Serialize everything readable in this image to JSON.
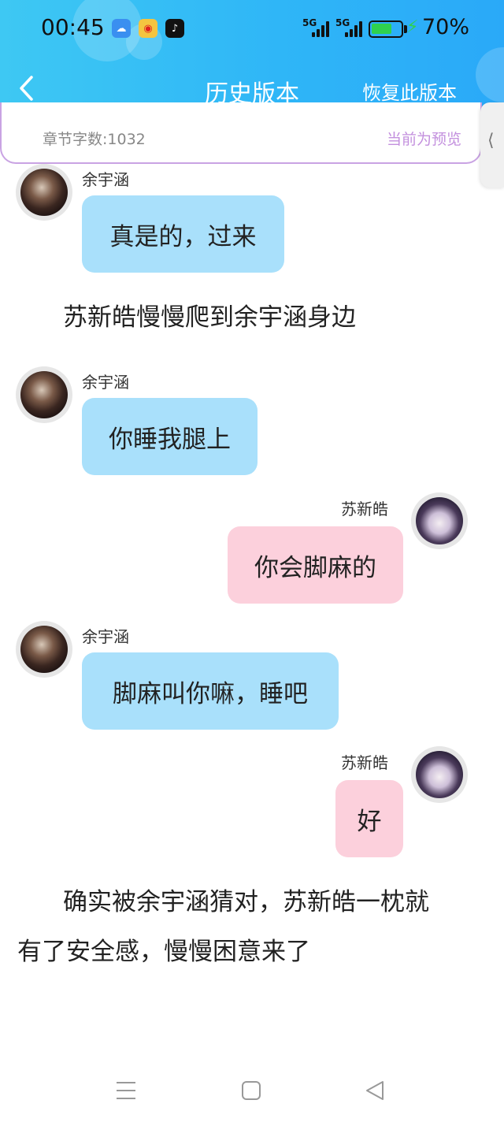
{
  "status": {
    "time": "00:45",
    "signal1": "5G",
    "signal2": "5G",
    "battery_level": 0.7,
    "battery_text": "70%",
    "app_icons": [
      "weather-icon",
      "weibo-icon",
      "tiktok-icon"
    ]
  },
  "header": {
    "title": "历史版本",
    "restore_label": "恢复此版本",
    "accent": "#2fb6f7"
  },
  "info": {
    "word_count": "章节字数:1032",
    "preview_label": "当前为预览"
  },
  "chat": {
    "msg1": {
      "speaker": "余宇涵",
      "text": "真是的，过来"
    },
    "narr1": "苏新皓慢慢爬到余宇涵身边",
    "msg2": {
      "speaker": "余宇涵",
      "text": "你睡我腿上"
    },
    "msg3": {
      "speaker": "苏新皓",
      "text": "你会脚麻的"
    },
    "msg4": {
      "speaker": "余宇涵",
      "text": "脚麻叫你嘛，睡吧"
    },
    "msg5": {
      "speaker": "苏新皓",
      "text": "好"
    },
    "narr2_line1": "确实被余宇涵猜对，苏新皓一枕就",
    "narr2_line2": "有了安全感，慢慢困意来了"
  },
  "colors": {
    "left_bubble": "#a9e0fb",
    "right_bubble": "#fcd0dc",
    "preview_text": "#c390de"
  }
}
